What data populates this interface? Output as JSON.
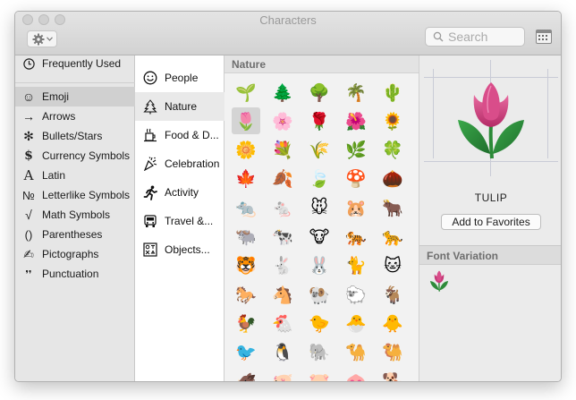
{
  "window": {
    "title": "Characters"
  },
  "toolbar": {
    "search_placeholder": "Search"
  },
  "sidebar": {
    "items": [
      {
        "label": "Frequently Used",
        "icon": "clock-icon",
        "glyph": "◷"
      },
      {
        "label": "Emoji",
        "icon": "smiley-icon",
        "glyph": "☺"
      },
      {
        "label": "Arrows",
        "icon": "arrow-icon",
        "glyph": "→"
      },
      {
        "label": "Bullets/Stars",
        "icon": "asterisk-icon",
        "glyph": "✻"
      },
      {
        "label": "Currency Symbols",
        "icon": "dollar-icon",
        "glyph": "$"
      },
      {
        "label": "Latin",
        "icon": "latin-a-icon",
        "glyph": "A"
      },
      {
        "label": "Letterlike Symbols",
        "icon": "numero-icon",
        "glyph": "№"
      },
      {
        "label": "Math Symbols",
        "icon": "sqrt-icon",
        "glyph": "√"
      },
      {
        "label": "Parentheses",
        "icon": "parentheses-icon",
        "glyph": "()"
      },
      {
        "label": "Pictographs",
        "icon": "pencil-hand-icon",
        "glyph": "✍"
      },
      {
        "label": "Punctuation",
        "icon": "punctuation-icon",
        "glyph": "❜❜"
      }
    ]
  },
  "subcategories": {
    "items": [
      {
        "label": "People",
        "icon": "smiley-face-icon",
        "glyph": "☺"
      },
      {
        "label": "Nature",
        "icon": "tree-icon",
        "glyph": "⍋"
      },
      {
        "label": "Food & D...",
        "icon": "food-icon",
        "glyph": "☕"
      },
      {
        "label": "Celebration",
        "icon": "party-popper-icon",
        "glyph": "✲"
      },
      {
        "label": "Activity",
        "icon": "runner-icon",
        "glyph": "⛹"
      },
      {
        "label": "Travel &...",
        "icon": "car-icon",
        "glyph": "⛟"
      },
      {
        "label": "Objects...",
        "icon": "objects-icon",
        "glyph": "⚙"
      }
    ]
  },
  "grid": {
    "section_title": "Nature",
    "rows": [
      [
        "🌱",
        "🌲",
        "🌳",
        "🌴",
        "🌵"
      ],
      [
        "🌷",
        "🌸",
        "🌹",
        "🌺",
        "🌻"
      ],
      [
        "🌼",
        "💐",
        "🌾",
        "🌿",
        "🍀"
      ],
      [
        "🍁",
        "🍂",
        "🍃",
        "🍄",
        "🌰"
      ],
      [
        "🐀",
        "🐁",
        "🐭",
        "🐹",
        "🐂"
      ],
      [
        "🐃",
        "🐄",
        "🐮",
        "🐅",
        "🐆"
      ],
      [
        "🐯",
        "🐇",
        "🐰",
        "🐈",
        "🐱"
      ],
      [
        "🐎",
        "🐴",
        "🐏",
        "🐑",
        "🐐"
      ],
      [
        "🐓",
        "🐔",
        "🐤",
        "🐣",
        "🐥"
      ],
      [
        "🐦",
        "🐧",
        "🐘",
        "🐪",
        "🐫"
      ],
      [
        "🐗",
        "🐖",
        "🐷",
        "🐽",
        "🐕"
      ]
    ]
  },
  "detail": {
    "char_name": "TULIP",
    "add_favorites_label": "Add to Favorites",
    "font_variation_title": "Font Variation"
  },
  "colors": {
    "selection_gray": "#d0d0d0",
    "tulip_petal": "#d3437f",
    "tulip_leaf": "#2e8b3a"
  }
}
